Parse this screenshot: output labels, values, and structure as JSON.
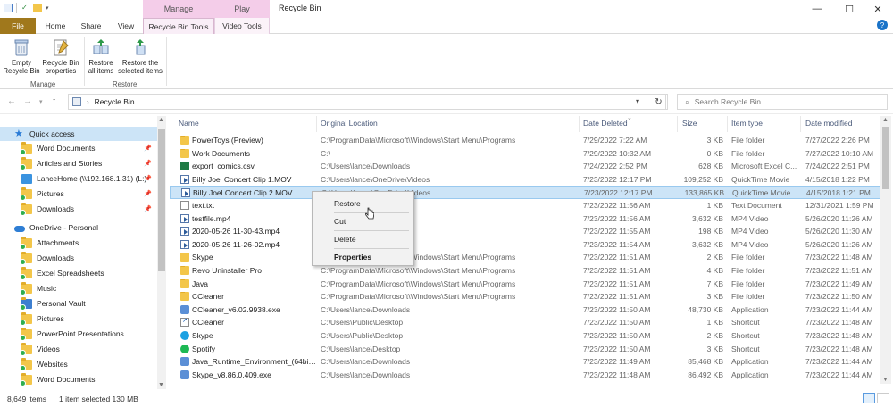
{
  "window": {
    "title": "Recycle Bin",
    "context_tab_groups": [
      "Manage",
      "Play"
    ],
    "controls": {
      "minimize": "—",
      "maximize": "☐",
      "close": "✕"
    }
  },
  "ribbon_tabs": [
    {
      "label": "File"
    },
    {
      "label": "Home"
    },
    {
      "label": "Share"
    },
    {
      "label": "View"
    },
    {
      "label": "Recycle Bin Tools"
    },
    {
      "label": "Video Tools"
    }
  ],
  "ribbon": {
    "manage": {
      "label": "Manage",
      "empty_label": "Empty\nRecycle Bin",
      "properties_label": "Recycle Bin\nproperties"
    },
    "restore": {
      "label": "Restore",
      "all_label": "Restore\nall items",
      "selected_label": "Restore the\nselected items"
    }
  },
  "address": {
    "path": "Recycle Bin",
    "search_placeholder": "Search Recycle Bin"
  },
  "nav": {
    "items": [
      {
        "label": "Quick access"
      },
      {
        "label": "Word Documents"
      },
      {
        "label": "Articles and Stories"
      },
      {
        "label": "LanceHome (\\\\192.168.1.31) (L:)"
      },
      {
        "label": "Pictures"
      },
      {
        "label": "Downloads"
      },
      {
        "label": "OneDrive - Personal"
      },
      {
        "label": "Attachments"
      },
      {
        "label": "Downloads"
      },
      {
        "label": "Excel Spreadsheets"
      },
      {
        "label": "Music"
      },
      {
        "label": "Personal Vault"
      },
      {
        "label": "Pictures"
      },
      {
        "label": "PowerPoint Presentations"
      },
      {
        "label": "Videos"
      },
      {
        "label": "Websites"
      },
      {
        "label": "Word Documents"
      }
    ]
  },
  "columns": {
    "name": "Name",
    "original_location": "Original Location",
    "date_deleted": "Date Deleted",
    "size": "Size",
    "item_type": "Item type",
    "date_modified": "Date modified"
  },
  "files": [
    {
      "name": "PowerToys (Preview)",
      "location": "C:\\ProgramData\\Microsoft\\Windows\\Start Menu\\Programs",
      "deleted": "7/29/2022 7:22 AM",
      "size": "3 KB",
      "type": "File folder",
      "modified": "7/27/2022 2:26 PM",
      "icon": "folder"
    },
    {
      "name": "Work Documents",
      "location": "C:\\",
      "deleted": "7/29/2022 10:32 AM",
      "size": "0 KB",
      "type": "File folder",
      "modified": "7/27/2022 10:10 AM",
      "icon": "folder"
    },
    {
      "name": "export_comics.csv",
      "location": "C:\\Users\\lance\\Downloads",
      "deleted": "7/24/2022 2:52 PM",
      "size": "628 KB",
      "type": "Microsoft Excel C...",
      "modified": "7/24/2022 2:51 PM",
      "icon": "csv"
    },
    {
      "name": "Billy Joel Concert Clip 1.MOV",
      "location": "C:\\Users\\lance\\OneDrive\\Videos",
      "deleted": "7/23/2022 12:17 PM",
      "size": "109,252 KB",
      "type": "QuickTime Movie",
      "modified": "4/15/2018 1:22 PM",
      "icon": "video"
    },
    {
      "name": "Billy Joel Concert Clip 2.MOV",
      "location": "C:\\Users\\lance\\OneDrive\\Videos",
      "deleted": "7/23/2022 12:17 PM",
      "size": "133,865 KB",
      "type": "QuickTime Movie",
      "modified": "4/15/2018 1:21 PM",
      "icon": "video"
    },
    {
      "name": "text.txt",
      "location": "C:\\Users\\lance\\Videos",
      "deleted": "7/23/2022 11:56 AM",
      "size": "1 KB",
      "type": "Text Document",
      "modified": "12/31/2021 1:59 PM",
      "icon": "file"
    },
    {
      "name": "testfile.mp4",
      "location": "C:\\Users\\lance\\Videos",
      "deleted": "7/23/2022 11:56 AM",
      "size": "3,632 KB",
      "type": "MP4 Video",
      "modified": "5/26/2020 11:26 AM",
      "icon": "video"
    },
    {
      "name": "2020-05-26 11-30-43.mp4",
      "location": "C:\\Users\\lance\\Videos",
      "deleted": "7/23/2022 11:55 AM",
      "size": "198 KB",
      "type": "MP4 Video",
      "modified": "5/26/2020 11:30 AM",
      "icon": "video"
    },
    {
      "name": "2020-05-26 11-26-02.mp4",
      "location": "C:\\Users\\lance\\Videos",
      "deleted": "7/23/2022 11:54 AM",
      "size": "3,632 KB",
      "type": "MP4 Video",
      "modified": "5/26/2020 11:26 AM",
      "icon": "video"
    },
    {
      "name": "Skype",
      "location": "C:\\ProgramData\\Microsoft\\Windows\\Start Menu\\Programs",
      "deleted": "7/23/2022 11:51 AM",
      "size": "2 KB",
      "type": "File folder",
      "modified": "7/23/2022 11:48 AM",
      "icon": "folder"
    },
    {
      "name": "Revo Uninstaller Pro",
      "location": "C:\\ProgramData\\Microsoft\\Windows\\Start Menu\\Programs",
      "deleted": "7/23/2022 11:51 AM",
      "size": "4 KB",
      "type": "File folder",
      "modified": "7/23/2022 11:51 AM",
      "icon": "folder"
    },
    {
      "name": "Java",
      "location": "C:\\ProgramData\\Microsoft\\Windows\\Start Menu\\Programs",
      "deleted": "7/23/2022 11:51 AM",
      "size": "7 KB",
      "type": "File folder",
      "modified": "7/23/2022 11:49 AM",
      "icon": "folder"
    },
    {
      "name": "CCleaner",
      "location": "C:\\ProgramData\\Microsoft\\Windows\\Start Menu\\Programs",
      "deleted": "7/23/2022 11:51 AM",
      "size": "3 KB",
      "type": "File folder",
      "modified": "7/23/2022 11:50 AM",
      "icon": "folder"
    },
    {
      "name": "CCleaner_v6.02.9938.exe",
      "location": "C:\\Users\\lance\\Downloads",
      "deleted": "7/23/2022 11:50 AM",
      "size": "48,730 KB",
      "type": "Application",
      "modified": "7/23/2022 11:44 AM",
      "icon": "app"
    },
    {
      "name": "CCleaner",
      "location": "C:\\Users\\Public\\Desktop",
      "deleted": "7/23/2022 11:50 AM",
      "size": "1 KB",
      "type": "Shortcut",
      "modified": "7/23/2022 11:48 AM",
      "icon": "shortcut"
    },
    {
      "name": "Skype",
      "location": "C:\\Users\\Public\\Desktop",
      "deleted": "7/23/2022 11:50 AM",
      "size": "2 KB",
      "type": "Shortcut",
      "modified": "7/23/2022 11:48 AM",
      "icon": "skype"
    },
    {
      "name": "Spotify",
      "location": "C:\\Users\\lance\\Desktop",
      "deleted": "7/23/2022 11:50 AM",
      "size": "3 KB",
      "type": "Shortcut",
      "modified": "7/23/2022 11:48 AM",
      "icon": "spotify"
    },
    {
      "name": "Java_Runtime_Environment_(64bit)...",
      "location": "C:\\Users\\lance\\Downloads",
      "deleted": "7/23/2022 11:49 AM",
      "size": "85,468 KB",
      "type": "Application",
      "modified": "7/23/2022 11:44 AM",
      "icon": "app"
    },
    {
      "name": "Skype_v8.86.0.409.exe",
      "location": "C:\\Users\\lance\\Downloads",
      "deleted": "7/23/2022 11:48 AM",
      "size": "86,492 KB",
      "type": "Application",
      "modified": "7/23/2022 11:44 AM",
      "icon": "app"
    }
  ],
  "context_menu": {
    "restore": "Restore",
    "cut": "Cut",
    "delete": "Delete",
    "properties": "Properties"
  },
  "status": {
    "item_count": "8,649 items",
    "selection": "1 item selected  130 MB"
  }
}
